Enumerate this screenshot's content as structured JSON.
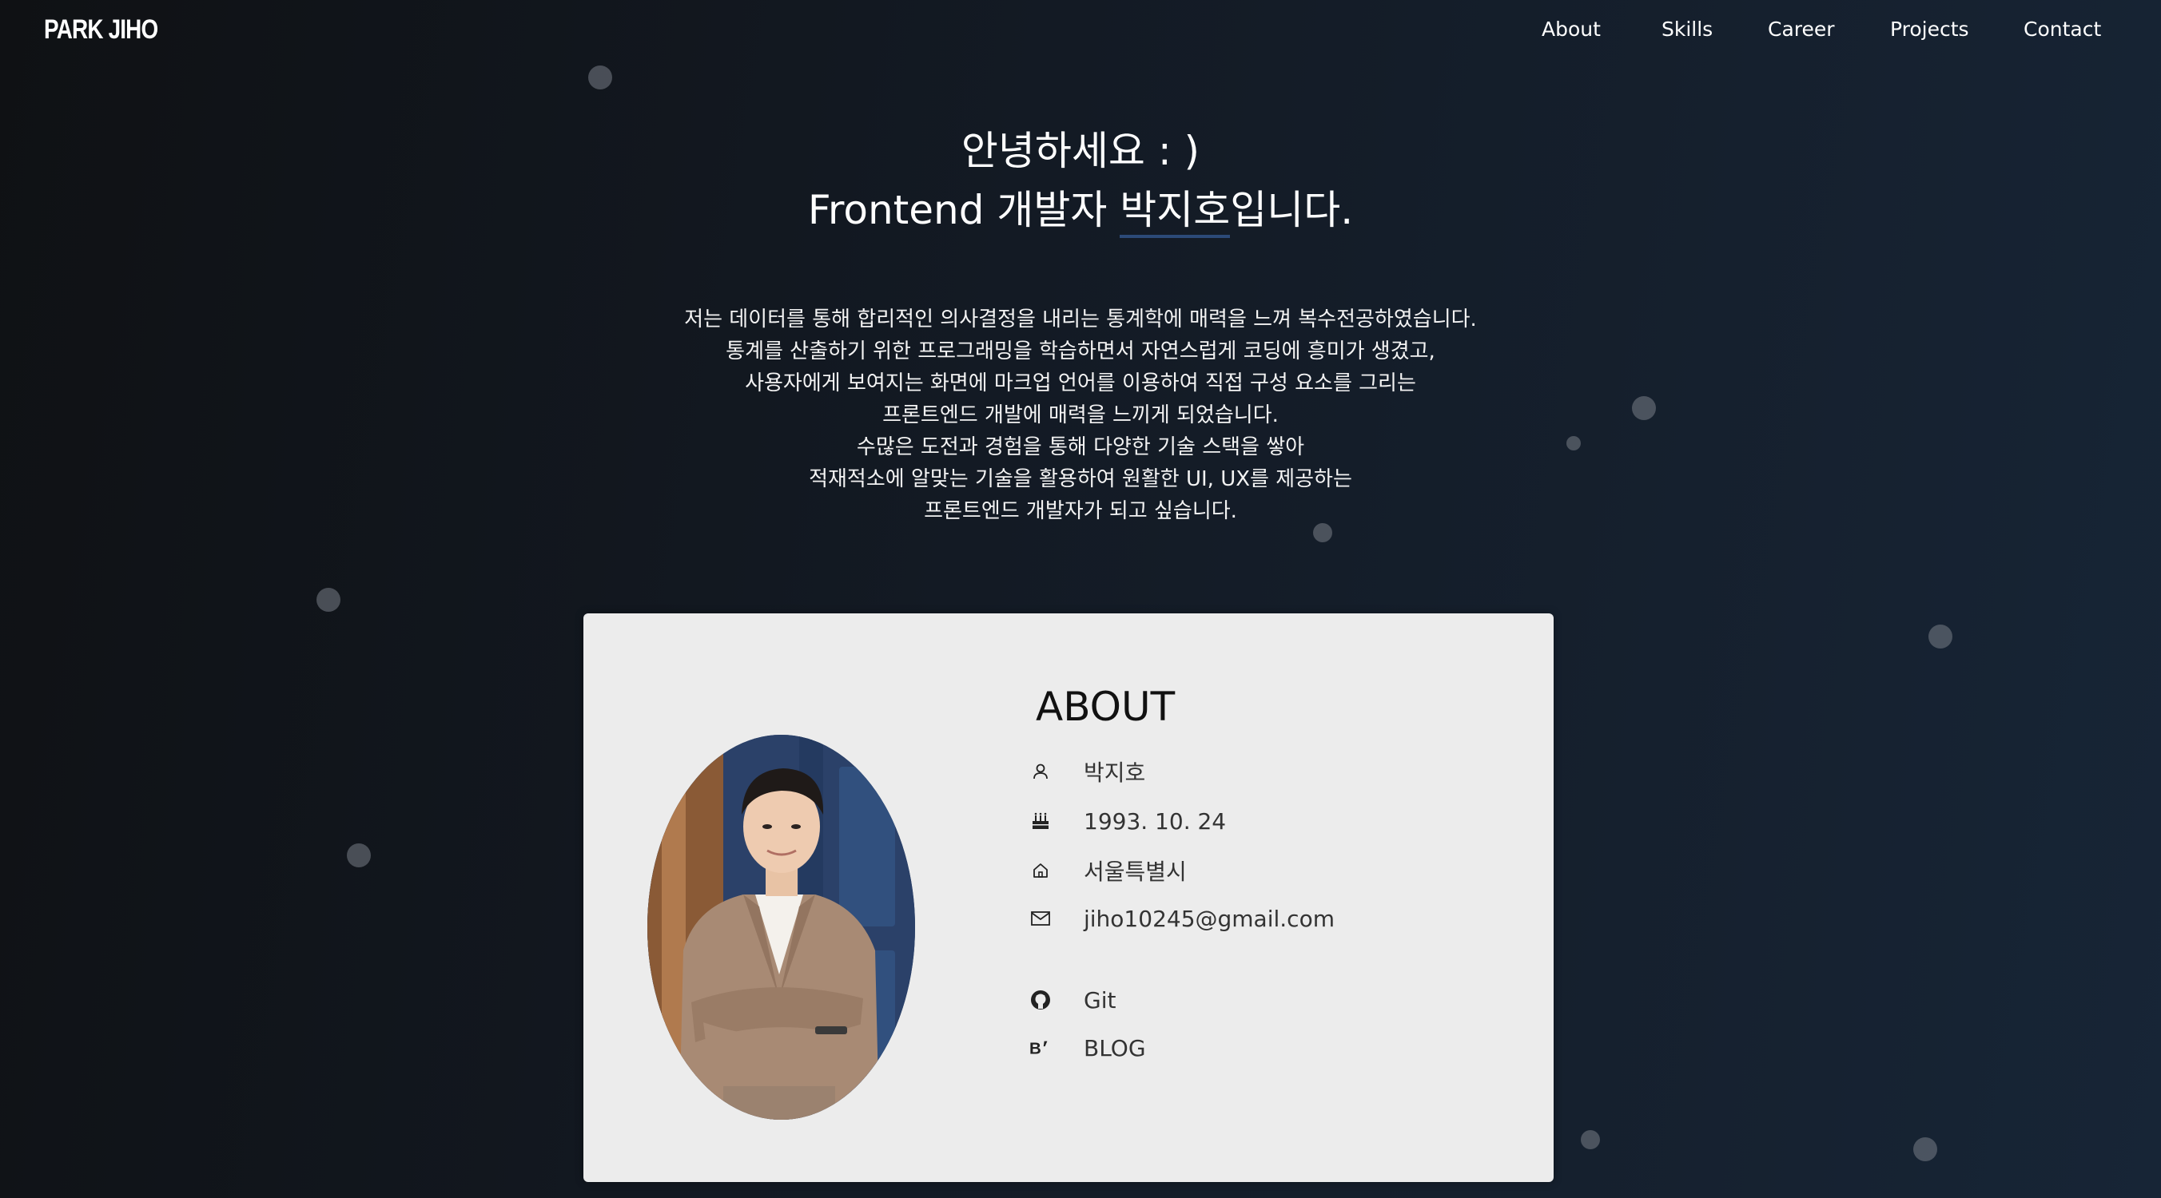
{
  "nav": {
    "logo": "PARK JIHO",
    "items": [
      {
        "label": "About"
      },
      {
        "label": "Skills"
      },
      {
        "label": "Career"
      },
      {
        "label": "Projects"
      },
      {
        "label": "Contact"
      }
    ]
  },
  "hero": {
    "greeting": "안녕하세요 : )",
    "role_prefix": "Frontend 개발자 ",
    "name": "박지호",
    "role_suffix": "입니다."
  },
  "intro": {
    "lines": [
      "저는 데이터를 통해 합리적인 의사결정을 내리는 통계학에 매력을 느껴 복수전공하였습니다.",
      "통계를 산출하기 위한 프로그래밍을 학습하면서 자연스럽게 코딩에 흥미가 생겼고,",
      "사용자에게 보여지는 화면에 마크업 언어를 이용하여 직접 구성 요소를 그리는",
      "프론트엔드 개발에 매력을 느끼게 되었습니다.",
      "수많은 도전과 경험을 통해 다양한 기술 스택을 쌓아",
      "적재적소에 알맞는 기술을 활용하여 원활한 UI, UX를 제공하는",
      "프론트엔드 개발자가 되고 싶습니다."
    ]
  },
  "about": {
    "title": "ABOUT",
    "name": "박지호",
    "birth": "1993. 10. 24",
    "location": "서울특별시",
    "email": "jiho10245@gmail.com",
    "git_label": "Git",
    "blog_label": "BLOG",
    "icons": [
      "person-icon",
      "cake-icon",
      "home-icon",
      "mail-icon",
      "github-icon",
      "blog-icon"
    ]
  },
  "colors": {
    "background_start": "#0f1114",
    "background_end": "#172536",
    "card": "#ececec",
    "name_underline": "#2c4a78"
  }
}
